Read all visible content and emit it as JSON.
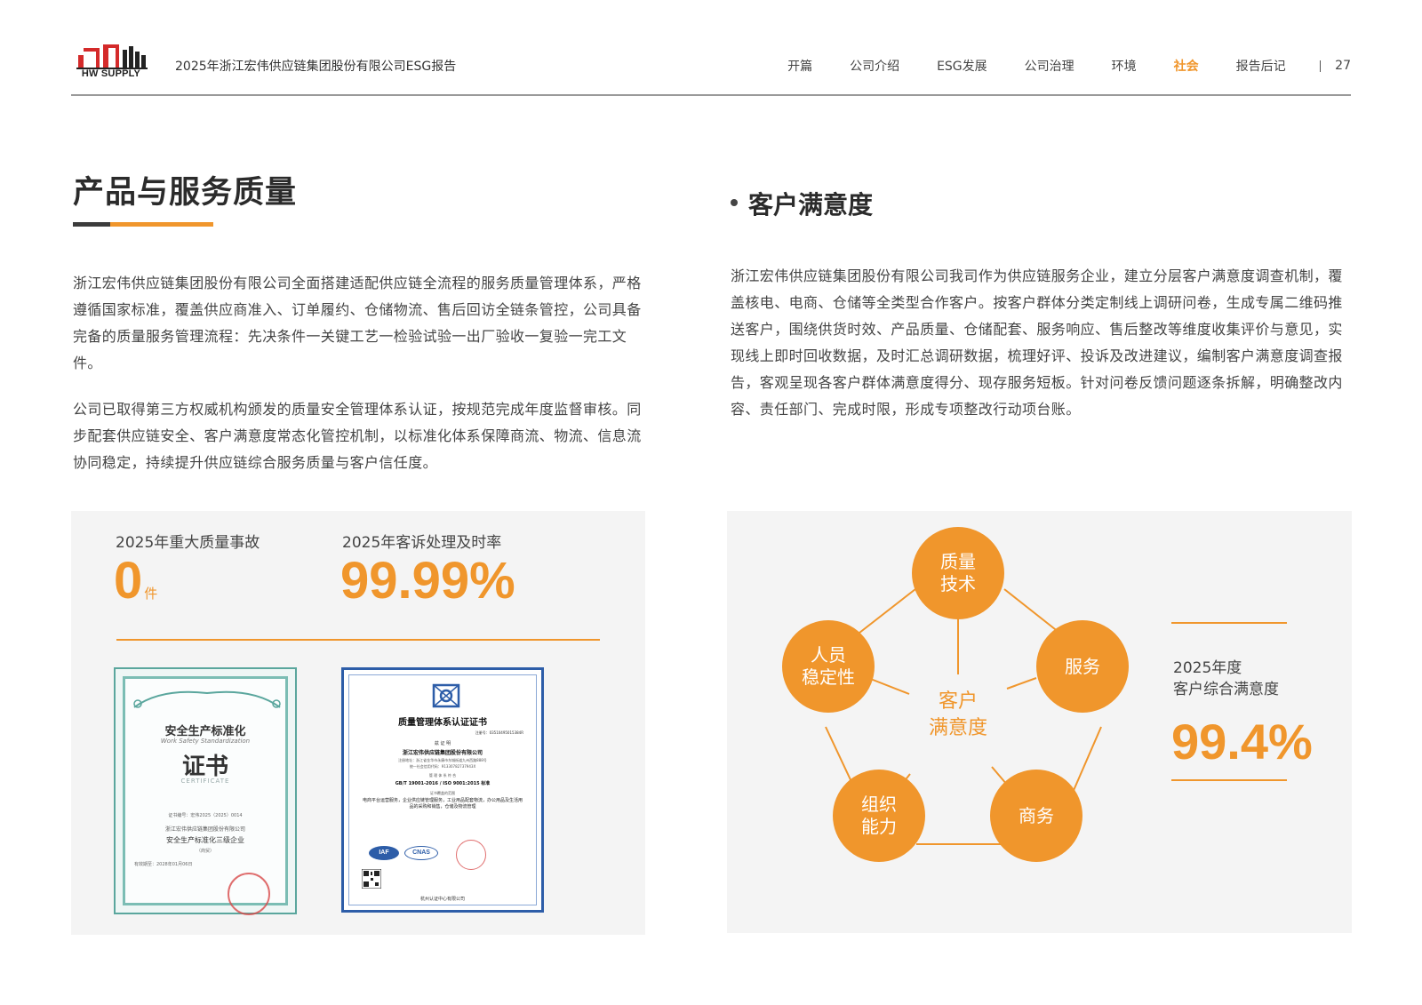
{
  "header": {
    "logo_text": "HW SUPPLY",
    "report_title": "2025年浙江宏伟供应链集团股份有限公司ESG报告",
    "nav": [
      "开篇",
      "公司介绍",
      "ESG发展",
      "公司治理",
      "环境",
      "社会",
      "报告后记"
    ],
    "active_nav": "社会",
    "page_number": "27"
  },
  "left": {
    "section_title": "产品与服务质量",
    "para1": "浙江宏伟供应链集团股份有限公司全面搭建适配供应链全流程的服务质量管理体系，严格遵循国家标准，覆盖供应商准入、订单履约、仓储物流、售后回访全链条管控，公司具备完备的质量服务管理流程：先决条件一关键工艺一检验试验一出厂验收一复验一完工文件。",
    "para2": "公司已取得第三方权威机构颁发的质量安全管理体系认证，按规范完成年度监督审核。同步配套供应链安全、客户满意度常态化管控机制，以标准化体系保障商流、物流、信息流协同稳定，持续提升供应链综合服务质量与客户信任度。",
    "stats": {
      "accident_label": "2025年重大质量事故",
      "accident_value": "0",
      "accident_unit": "件",
      "complaint_label": "2025年客诉处理及时率",
      "complaint_value": "99.99%"
    },
    "cert_a": {
      "title": "安全生产标准化",
      "subtitle": "Work Safety Standardization",
      "big": "证书",
      "en": "CERTIFICATE",
      "number": "证书编号：宏伟2025（2025）0014",
      "company": "浙江宏伟供应链集团股份有限公司",
      "grade": "安全生产标准化三级企业",
      "scope": "（商贸）",
      "date": "有效期至：2028年01月06日"
    },
    "cert_b": {
      "title": "质量管理体系认证证书",
      "number": "注册号：03510495015384R",
      "lead": "兹  证  明",
      "company": "浙江宏伟供应链集团股份有限公司",
      "addr": "注册地址：浙江省金华市永康市东城街道九州西路888号",
      "credit": "统一社会信用代码：91330782737943X",
      "std_lead": "管  理  体  系  符  合",
      "standard": "GB/T 19001-2016 / ISO 9001:2015 标准",
      "scope_title": "证书覆盖的范围",
      "scope": "电商平台运营服务，企业供应链管理服务，工业用品配套物流，办公用品及生活用品的采购和销售，仓储及物流管理",
      "iaf": "IAF",
      "cnas": "CNAS",
      "footer": "杭州认证中心有限公司"
    }
  },
  "right": {
    "sub_title": "客户满意度",
    "para": "浙江宏伟供应链集团股份有限公司我司作为供应链服务企业，建立分层客户满意度调查机制，覆盖核电、电商、仓储等全类型合作客户。按客户群体分类定制线上调研问卷，生成专属二维码推送客户，围绕供货时效、产品质量、仓储配套、服务响应、售后整改等维度收集评价与意见，实现线上即时回收数据，及时汇总调研数据，梳理好评、投诉及改进建议，编制客户满意度调查报告，客观呈现各客户群体满意度得分、现存服务短板。针对问卷反馈问题逐条拆解，明确整改内容、责任部门、完成时限，形成专项整改行动项台账。",
    "diagram": {
      "center_line1": "客户",
      "center_line2": "满意度",
      "quality_l1": "质量",
      "quality_l2": "技术",
      "service": "服务",
      "business": "商务",
      "org_l1": "组织",
      "org_l2": "能力",
      "staff_l1": "人员",
      "staff_l2": "稳定性"
    },
    "satisfaction": {
      "label1": "2025年度",
      "label2": "客户综合满意度",
      "value": "99.4%"
    }
  },
  "colors": {
    "accent": "#f0962c",
    "dark": "#3c3c3c",
    "text": "#444444"
  }
}
